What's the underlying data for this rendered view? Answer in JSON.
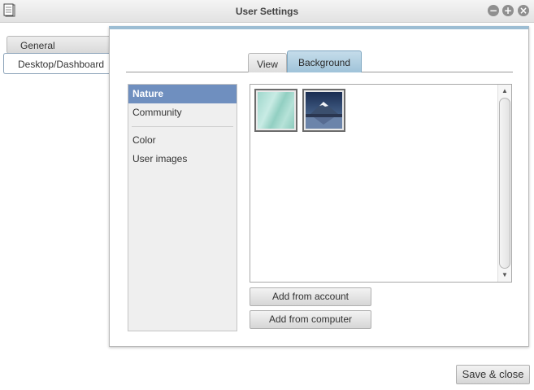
{
  "window": {
    "title": "User Settings",
    "app_icon": "notepad-icon",
    "controls": {
      "minimize_icon": "minus-icon",
      "maximize_icon": "plus-icon",
      "close_icon": "close-icon",
      "minimize_glyph": "−",
      "maximize_glyph": "+",
      "close_glyph": "×"
    }
  },
  "left_tabs": [
    {
      "label": "General",
      "active": false
    },
    {
      "label": "Desktop/Dashboard",
      "active": true
    }
  ],
  "inner_tabs": [
    {
      "label": "View",
      "active": false
    },
    {
      "label": "Background",
      "active": true
    }
  ],
  "categories": {
    "group1": [
      {
        "label": "Nature",
        "selected": true
      },
      {
        "label": "Community",
        "selected": false
      }
    ],
    "group2": [
      {
        "label": "Color",
        "selected": false
      },
      {
        "label": "User images",
        "selected": false
      }
    ]
  },
  "images": [
    {
      "name": "teal-abstract-thumbnail",
      "selected": false
    },
    {
      "name": "mountain-lake-thumbnail",
      "selected": false
    }
  ],
  "buttons": {
    "add_from_account": "Add from account",
    "add_from_computer": "Add from computer",
    "save_close": "Save & close"
  },
  "colors": {
    "accent": "#9cbdd3",
    "selection": "#6f8fbf",
    "active_tab": "#a8c9dd"
  }
}
